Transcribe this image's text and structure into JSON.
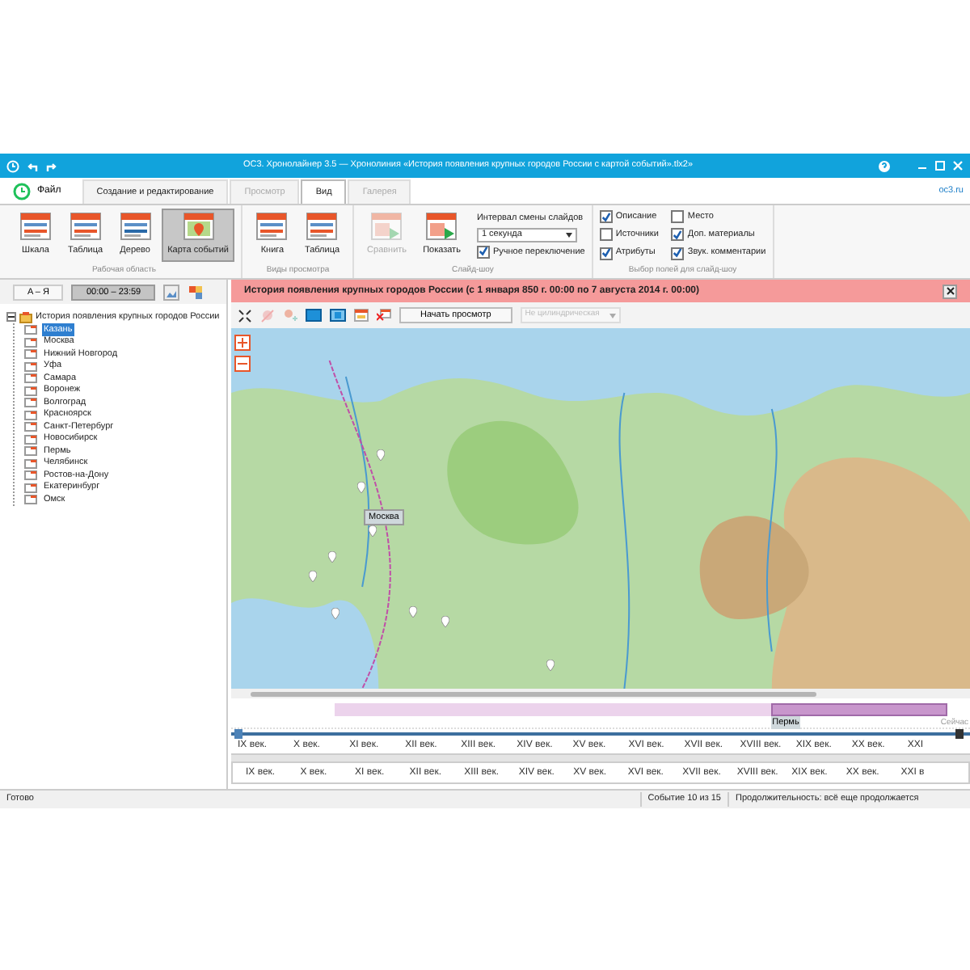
{
  "window": {
    "title": "ОС3. Хронолайнер 3.5 — Хронолиния «История появления крупных городов России с картой событий».tlx2»"
  },
  "menu": {
    "file": "Файл",
    "site_link": "oc3.ru"
  },
  "tabs": [
    {
      "label": "Создание и редактирование",
      "selected": false,
      "disabled": false
    },
    {
      "label": "Просмотр",
      "selected": false,
      "disabled": true
    },
    {
      "label": "Вид",
      "selected": true,
      "disabled": false
    },
    {
      "label": "Галерея",
      "selected": false,
      "disabled": true
    }
  ],
  "ribbon": {
    "groups": [
      {
        "label": "Рабочая область",
        "buttons": [
          {
            "label": "Шкала",
            "selected": false,
            "disabled": false
          },
          {
            "label": "Таблица",
            "selected": false,
            "disabled": false
          },
          {
            "label": "Дерево",
            "selected": false,
            "disabled": false
          },
          {
            "label": "Карта событий",
            "selected": true,
            "disabled": false
          }
        ]
      },
      {
        "label": "Виды просмотра",
        "buttons": [
          {
            "label": "Книга",
            "selected": false,
            "disabled": false
          },
          {
            "label": "Таблица",
            "selected": false,
            "disabled": false
          }
        ]
      },
      {
        "label": "Слайд-шоу",
        "buttons": [
          {
            "label": "Сравнить",
            "selected": false,
            "disabled": true
          },
          {
            "label": "Показать",
            "selected": false,
            "disabled": false
          }
        ]
      }
    ],
    "interval": {
      "label": "Интервал смены слайдов",
      "value": "1 секунда",
      "manual": {
        "label": "Ручное переключение",
        "checked": true
      }
    },
    "fields": {
      "label": "Выбор полей для слайд-шоу",
      "items": [
        {
          "label": "Описание",
          "checked": true
        },
        {
          "label": "Место",
          "checked": false
        },
        {
          "label": "Источники",
          "checked": false
        },
        {
          "label": "Доп. материалы",
          "checked": true
        },
        {
          "label": "Атрибуты",
          "checked": true
        },
        {
          "label": "Звук. комментарии",
          "checked": true
        }
      ]
    }
  },
  "left_toolbar": [
    {
      "label": "A – Я",
      "selected": false
    },
    {
      "label": "00:00 – 23:59",
      "selected": true
    }
  ],
  "tree": {
    "label": "История появления крупных городов России",
    "expanded": true,
    "children": [
      {
        "label": "Казань",
        "selected": true
      },
      {
        "label": "Москва",
        "selected": false
      },
      {
        "label": "Нижний Новгород",
        "selected": false
      },
      {
        "label": "Уфа",
        "selected": false
      },
      {
        "label": "Самара",
        "selected": false
      },
      {
        "label": "Воронеж",
        "selected": false
      },
      {
        "label": "Волгоград",
        "selected": false
      },
      {
        "label": "Красноярск",
        "selected": false
      },
      {
        "label": "Санкт-Петербург",
        "selected": false
      },
      {
        "label": "Новосибирск",
        "selected": false
      },
      {
        "label": "Пермь",
        "selected": false
      },
      {
        "label": "Челябинск",
        "selected": false
      },
      {
        "label": "Ростов-на-Дону",
        "selected": false
      },
      {
        "label": "Екатеринбург",
        "selected": false
      },
      {
        "label": "Омск",
        "selected": false
      }
    ]
  },
  "header": {
    "title": "История появления крупных городов России (с 1 января 850 г. 00:00 по 7 августа 2014 г. 00:00)"
  },
  "map_toolbar": {
    "start_button": "Начать просмотр",
    "projection": {
      "value": "Не цилиндрическая",
      "disabled": true
    }
  },
  "map": {
    "label": "Москва"
  },
  "timeline": {
    "events": [
      {
        "selected": false
      },
      {
        "label": "Пермь",
        "selected": true
      }
    ],
    "now": "Сейчас",
    "ruler": [
      "IX век.",
      "X век.",
      "XI век.",
      "XII век.",
      "XIII век.",
      "XIV век.",
      "XV век.",
      "XVI век.",
      "XVII век.",
      "XVIII век.",
      "XIX век.",
      "XX век.",
      "XXI"
    ],
    "overview": [
      "IX век.",
      "X век.",
      "XI век.",
      "XII век.",
      "XIII век.",
      "XIV век.",
      "XV век.",
      "XVI век.",
      "XVII век.",
      "XVIII век.",
      "XIX век.",
      "XX век.",
      "XXI в"
    ]
  },
  "status_bar": {
    "status": "Готово",
    "event": "Событие 10 из 15",
    "duration": "Продолжительность: всё еще продолжается"
  }
}
